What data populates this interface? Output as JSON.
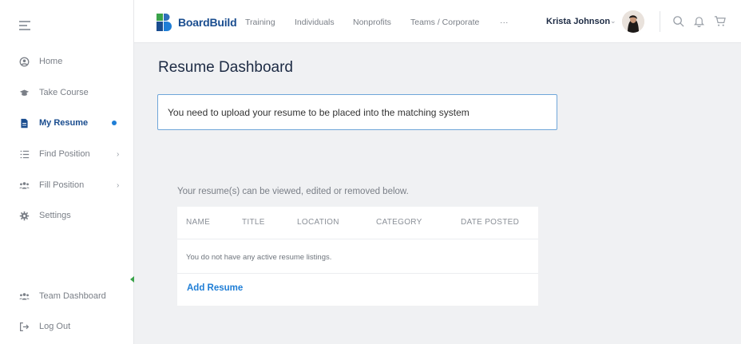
{
  "sidebar": {
    "items": [
      {
        "label": "Home",
        "icon": "user-circle-icon"
      },
      {
        "label": "Take Course",
        "icon": "graduation-cap-icon"
      },
      {
        "label": "My Resume",
        "icon": "document-icon",
        "active": true
      },
      {
        "label": "Find Position",
        "icon": "list-icon"
      },
      {
        "label": "Fill Position",
        "icon": "users-icon"
      },
      {
        "label": "Settings",
        "icon": "gear-icon"
      }
    ],
    "bottom": [
      {
        "label": "Team Dashboard",
        "icon": "users-icon"
      },
      {
        "label": "Log Out",
        "icon": "logout-icon"
      }
    ]
  },
  "topbar": {
    "brand": "BoardBuild",
    "nav": [
      "Training",
      "Individuals",
      "Nonprofits",
      "Teams / Corporate",
      "···"
    ],
    "user_name": "Krista Johnson"
  },
  "main": {
    "title": "Resume Dashboard",
    "alert": "You need to upload your resume to be placed into the matching system",
    "intro": "Your resume(s) can be viewed, edited or removed below.",
    "table": {
      "headers": [
        "NAME",
        "TITLE",
        "LOCATION",
        "CATEGORY",
        "DATE POSTED"
      ],
      "empty_message": "You do not have any active resume listings.",
      "add_label": "Add Resume"
    }
  },
  "colors": {
    "brand_blue": "#1a4d8f",
    "link_blue": "#1f7ed6",
    "alert_border": "#6fa6d9",
    "background": "#f0f1f3"
  }
}
